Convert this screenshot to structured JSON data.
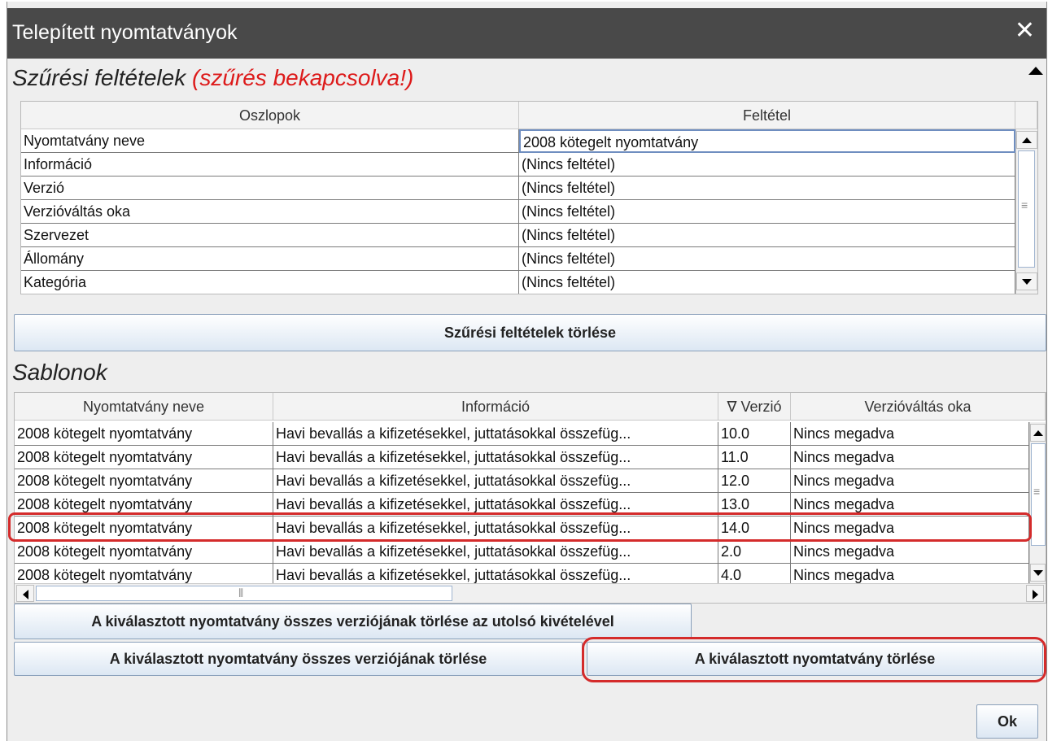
{
  "window": {
    "title": "Telepített nyomtatványok",
    "close_glyph": "✕"
  },
  "filter": {
    "title": "Szűrési feltételek",
    "status": "(szűrés bekapcsolva!)",
    "columns": [
      "Oszlopok",
      "Feltétel"
    ],
    "rows": [
      {
        "column": "Nyomtatvány neve",
        "condition": "2008 kötegelt nyomtatvány"
      },
      {
        "column": "Információ",
        "condition": "(Nincs feltétel)"
      },
      {
        "column": "Verzió",
        "condition": "(Nincs feltétel)"
      },
      {
        "column": "Verzióváltás oka",
        "condition": "(Nincs feltétel)"
      },
      {
        "column": "Szervezet",
        "condition": "(Nincs feltétel)"
      },
      {
        "column": "Állomány",
        "condition": "(Nincs feltétel)"
      },
      {
        "column": "Kategória",
        "condition": "(Nincs feltétel)"
      }
    ],
    "clear_button": "Szűrési feltételek törlése"
  },
  "templates": {
    "title": "Sablonok",
    "columns": [
      "Nyomtatvány neve",
      "Információ",
      "∇ Verzió",
      "Verzióváltás oka"
    ],
    "rows": [
      {
        "name": "2008 kötegelt nyomtatvány",
        "info": "Havi bevallás a kifizetésekkel, juttatásokkal összefüg...",
        "version": "10.0",
        "reason": "Nincs megadva"
      },
      {
        "name": "2008 kötegelt nyomtatvány",
        "info": "Havi bevallás a kifizetésekkel, juttatásokkal összefüg...",
        "version": "11.0",
        "reason": "Nincs megadva"
      },
      {
        "name": "2008 kötegelt nyomtatvány",
        "info": "Havi bevallás a kifizetésekkel, juttatásokkal összefüg...",
        "version": "12.0",
        "reason": "Nincs megadva"
      },
      {
        "name": "2008 kötegelt nyomtatvány",
        "info": "Havi bevallás a kifizetésekkel, juttatásokkal összefüg...",
        "version": "13.0",
        "reason": "Nincs megadva"
      },
      {
        "name": "2008 kötegelt nyomtatvány",
        "info": "Havi bevallás a kifizetésekkel, juttatásokkal összefüg...",
        "version": "14.0",
        "reason": "Nincs megadva"
      },
      {
        "name": "2008 kötegelt nyomtatvány",
        "info": "Havi bevallás a kifizetésekkel, juttatásokkal összefüg...",
        "version": "2.0",
        "reason": "Nincs megadva"
      },
      {
        "name": "2008 kötegelt nyomtatvány",
        "info": "Havi bevallás a kifizetésekkel, juttatásokkal összefüg...",
        "version": "4.0",
        "reason": "Nincs megadva"
      }
    ],
    "selected_row": 4
  },
  "actions": {
    "delete_all_but_last": "A kiválasztott nyomtatvány összes verziójának törlése az utolsó kivételével",
    "delete_all_versions": "A kiválasztott nyomtatvány összes verziójának törlése",
    "delete_selected": "A kiválasztott nyomtatvány törlése",
    "ok": "Ok"
  },
  "colors": {
    "titlebar": "#494949",
    "filter_status": "#dd1a1a",
    "highlight": "#d42b2b"
  }
}
